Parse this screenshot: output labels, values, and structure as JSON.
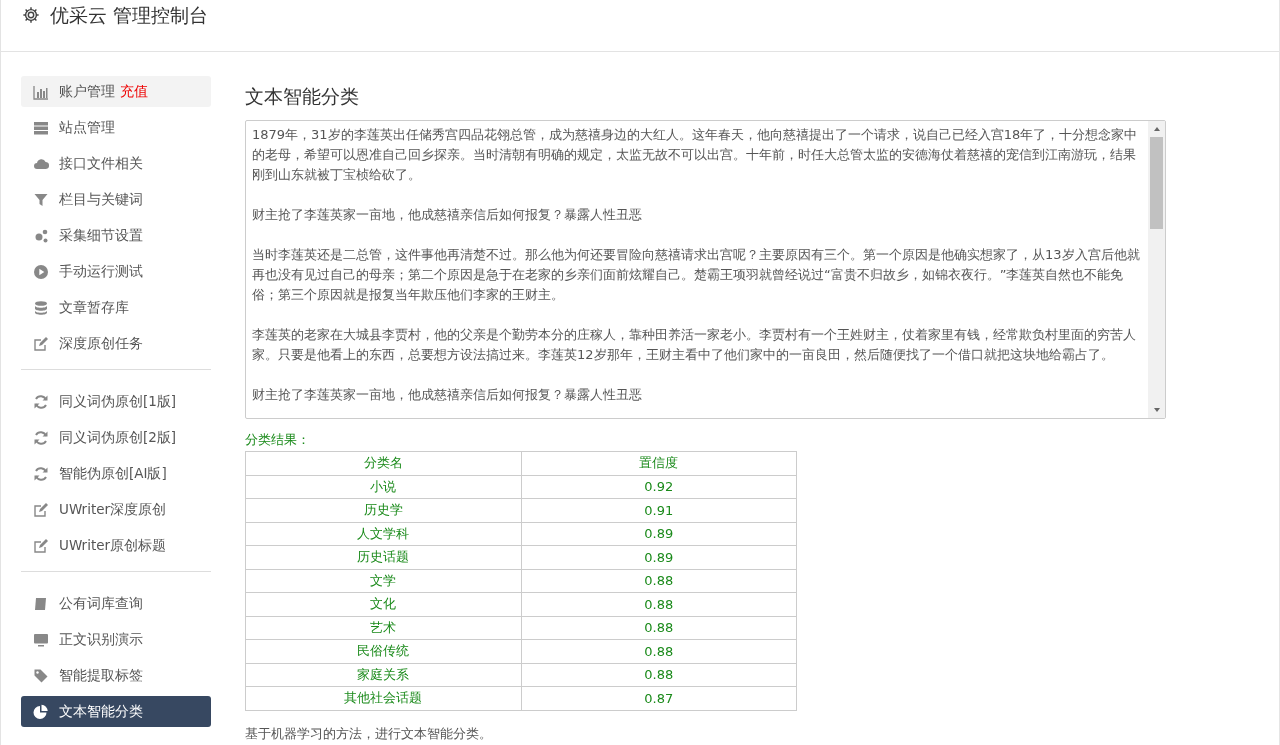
{
  "header": {
    "title": "优采云 管理控制台"
  },
  "sidebar": {
    "sections": [
      {
        "items": [
          {
            "label": "账户管理",
            "badge": "充值",
            "selected": false,
            "hovered": true
          },
          {
            "label": "站点管理",
            "selected": false,
            "hovered": false
          },
          {
            "label": "接口文件相关",
            "selected": false,
            "hovered": false
          },
          {
            "label": "栏目与关键词",
            "selected": false,
            "hovered": false
          },
          {
            "label": "采集细节设置",
            "selected": false,
            "hovered": false
          },
          {
            "label": "手动运行测试",
            "selected": false,
            "hovered": false
          },
          {
            "label": "文章暂存库",
            "selected": false,
            "hovered": false
          },
          {
            "label": "深度原创任务",
            "selected": false,
            "hovered": false
          }
        ]
      },
      {
        "items": [
          {
            "label": "同义词伪原创[1版]",
            "selected": false,
            "hovered": false
          },
          {
            "label": "同义词伪原创[2版]",
            "selected": false,
            "hovered": false
          },
          {
            "label": "智能伪原创[AI版]",
            "selected": false,
            "hovered": false
          },
          {
            "label": "UWriter深度原创",
            "selected": false,
            "hovered": false
          },
          {
            "label": "UWriter原创标题",
            "selected": false,
            "hovered": false
          }
        ]
      },
      {
        "items": [
          {
            "label": "公有词库查询",
            "selected": false,
            "hovered": false
          },
          {
            "label": "正文识别演示",
            "selected": false,
            "hovered": false
          },
          {
            "label": "智能提取标签",
            "selected": false,
            "hovered": false
          },
          {
            "label": "文本智能分类",
            "selected": true,
            "hovered": false
          }
        ]
      }
    ]
  },
  "main": {
    "title": "文本智能分类",
    "text_input": {
      "paragraphs": [
        "1879年，31岁的李莲英出任储秀宫四品花翎总管，成为慈禧身边的大红人。这年春天，他向慈禧提出了一个请求，说自己已经入宫18年了，十分想念家中的老母，希望可以恩准自己回乡探亲。当时清朝有明确的规定，太监无故不可以出宫。十年前，时任大总管太监的安德海仗着慈禧的宠信到江南游玩，结果刚到山东就被丁宝桢给砍了。",
        "财主抢了李莲英家一亩地，他成慈禧亲信后如何报复？暴露人性丑恶",
        "当时李莲英还是二总管，这件事他再清楚不过。那么他为何还要冒险向慈禧请求出宫呢？主要原因有三个。第一个原因是他确实想家了，从13岁入宫后他就再也没有见过自己的母亲；第二个原因是急于在老家的乡亲们面前炫耀自己。楚霸王项羽就曾经说过“富贵不归故乡，如锦衣夜行。”李莲英自然也不能免俗；第三个原因就是报复当年欺压他们李家的王财主。",
        "李莲英的老家在大城县李贾村，他的父亲是个勤劳本分的庄稼人，靠种田养活一家老小。李贾村有一个王姓财主，仗着家里有钱，经常欺负村里面的穷苦人家。只要是他看上的东西，总要想方设法搞过来。李莲英12岁那年，王财主看中了他们家中的一亩良田，然后随便找了一个借口就把这块地给霸占了。",
        "财主抢了李莲英家一亩地，他成慈禧亲信后如何报复？暴露人性丑恶"
      ]
    },
    "result_label": "分类结果：",
    "table": {
      "columns": [
        "分类名",
        "置信度"
      ],
      "rows": [
        [
          "小说",
          "0.92"
        ],
        [
          "历史学",
          "0.91"
        ],
        [
          "人文学科",
          "0.89"
        ],
        [
          "历史话题",
          "0.89"
        ],
        [
          "文学",
          "0.88"
        ],
        [
          "文化",
          "0.88"
        ],
        [
          "艺术",
          "0.88"
        ],
        [
          "民俗传统",
          "0.88"
        ],
        [
          "家庭关系",
          "0.88"
        ],
        [
          "其他社会话题",
          "0.87"
        ]
      ]
    },
    "note": "基于机器学习的方法，进行文本智能分类。"
  }
}
